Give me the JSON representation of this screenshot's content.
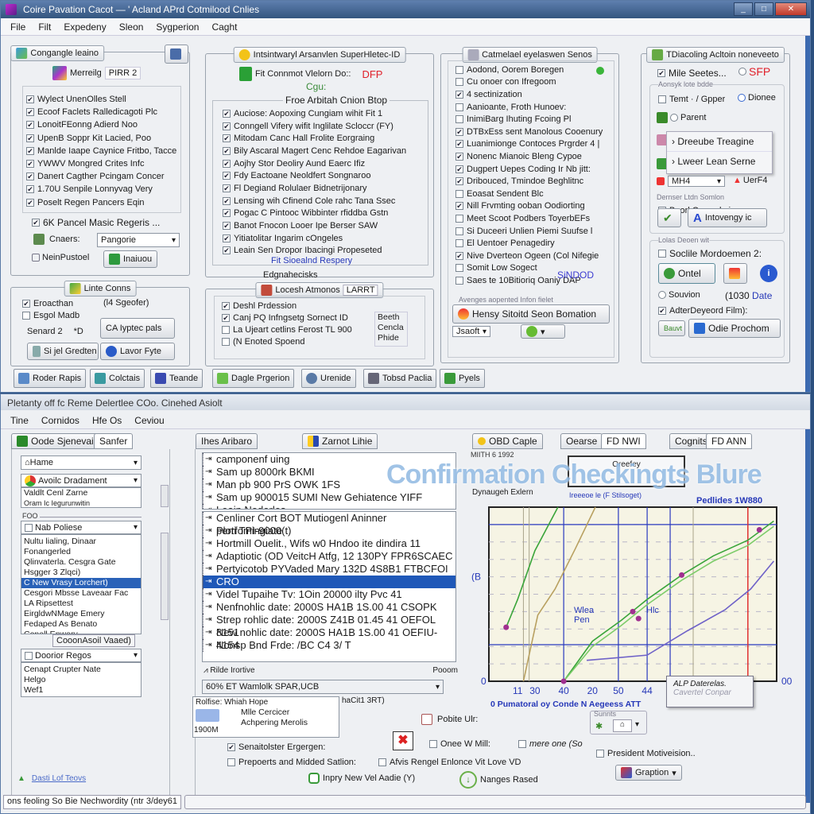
{
  "top_window": {
    "title": "Coire Pavation Cacot — ' Acland APrd Cotmilood Cnlies",
    "menu": [
      "File",
      "Filt",
      "Expedeny",
      "Sleon",
      "Sygperion",
      "Caght"
    ],
    "panel1": {
      "title": "Congangle leaino",
      "subtitle_label": "Merreilg",
      "subtitle_value": "PIRR 2",
      "items": [
        {
          "label": "Wylect UnenOlles Stell",
          "checked": true
        },
        {
          "label": "Ecoof Faclets Ralledicagoti Plc",
          "checked": true
        },
        {
          "label": "LonoitFEonng Adierd Noo",
          "checked": true
        },
        {
          "label": "UpenB Soppr Kit Lacied, Poo",
          "checked": true
        },
        {
          "label": "Manlde Iaape Caynice Fritbo, Tacce",
          "checked": true
        },
        {
          "label": "YWWV Mongred Crites Infc",
          "checked": true
        },
        {
          "label": "Danert Cagther Pcingam Concer",
          "checked": true
        },
        {
          "label": "1.70U Senpile Lonnyvag Very",
          "checked": true
        },
        {
          "label": "Poselt Regen Pancers Eqin",
          "checked": true
        }
      ],
      "option_label": "6K Pancel Masic Regeris ...",
      "combo_label": "Cnaers:",
      "combo_value": "Pangorie",
      "misc_label": "NeinPustoel",
      "misc_button": "Inaiuou"
    },
    "panel1b": {
      "title": "Linte Conns",
      "items": [
        {
          "label": "Eroacthan",
          "checked": true
        },
        {
          "label": "Esgol Madb",
          "checked": false
        }
      ],
      "side_label": "(l4 Sgeofer)",
      "field_label": "Senard 2",
      "field_value": "*D",
      "button_big": "CA Iyptec pals",
      "button_a": "Si jel Gredten",
      "button_b": "Lavor Fyte"
    },
    "panel2": {
      "title": "Intsintwaryl Arsanvlen SuperHletec-ID",
      "info_line": "Fit Connmot Vlelorn Do::",
      "info_flag": "DFP",
      "info_sub": "Cgu:",
      "fieldset_title": "Froe Arbitah Cnion Btop",
      "items": [
        {
          "label": "Auciose: Aopoxing Cungiam wihit Fit 1",
          "checked": true
        },
        {
          "label": "Conngell Vifery wifit Inglilate Scloccr (FY)",
          "checked": true
        },
        {
          "label": "Mitodam Canc Hall Frolite Eorgraing",
          "checked": true
        },
        {
          "label": "Bily Ascaral Magert Cenc Rehdoe Eagarivan",
          "checked": true
        },
        {
          "label": "Aojhy Stor Deoliry Aund Eaerc Ifiz",
          "checked": true
        },
        {
          "label": "Fdy Eactoane Neoldfert Songnaroo",
          "checked": true
        },
        {
          "label": "Fl Degiand Rolulaer Bidnetrijonary",
          "checked": true
        },
        {
          "label": "Lensing wih Cfinend Cole rahc Tana Ssec",
          "checked": true
        },
        {
          "label": "Pogac C Pintooc Wibbinter rfiddba Gstn",
          "checked": true
        },
        {
          "label": "Banot Fnocon Looer Ipe Berser SAW",
          "checked": true
        },
        {
          "label": "Yitiatolitar Ingarim cOngeles",
          "checked": true
        },
        {
          "label": "Leain Sen Dropor Ibacingi Propeseted",
          "checked": true
        }
      ],
      "footer_link": "Fit Sioealnd Respery"
    },
    "panel2b": {
      "caption": "Edgnahecisks",
      "title": "Locesh Atmonos",
      "title_badge": "LARRT",
      "items": [
        {
          "label": "Deshl Prdession",
          "checked": true
        },
        {
          "label": "Canj PQ Infngsetg Sornect ID",
          "checked": true
        },
        {
          "label": "La Ujeart cetlins  Ferost  TL 900",
          "checked": false
        },
        {
          "label": "(N Enoted Spoend",
          "checked": false
        }
      ],
      "side_list": [
        "Beeth",
        "Cencla",
        "Phide"
      ]
    },
    "panel3": {
      "title": "Catmelael eyelaswen Senos",
      "items": [
        {
          "label": "Aodond, Oorem Boregen",
          "checked": false
        },
        {
          "label": "Cu onoer con Ifregoom",
          "checked": false
        },
        {
          "label": "4 sectinization",
          "checked": true
        },
        {
          "label": "Aanioante, Froth Hunoev:",
          "checked": false
        },
        {
          "label": "InimiBarg Ihuting Fcoing Pl",
          "checked": false
        },
        {
          "label": "DTBxEss sent Manolous Cooenury",
          "checked": true
        },
        {
          "label": "Luanimionge Contoces Prgrder 4 |",
          "checked": true
        },
        {
          "label": "Nonenc Mianoic Bleng Cypoe",
          "checked": true
        },
        {
          "label": "Dugpert Uepes Coding Ir Nb jitt:",
          "checked": true
        },
        {
          "label": "Dribouced, Tmindoe Beghlitnc",
          "checked": true
        },
        {
          "label": "Eoasat Sendent Blc",
          "checked": false
        },
        {
          "label": "Nill Frvmting ooban Oodiorting",
          "checked": true
        },
        {
          "label": "Meet Scoot Podbers ToyerbEFs",
          "checked": false
        },
        {
          "label": "Si Duceeri Unlien Piemi Suufse l",
          "checked": false
        },
        {
          "label": "El Uentoer Penagediry",
          "checked": false
        },
        {
          "label": "Nive Dverteon Ogeen (Col Nifegie",
          "checked": true
        },
        {
          "label": "Somit Low Sogect",
          "checked": false
        },
        {
          "label": "Saes te 10Bitioriq Oaniy DAP",
          "checked": false
        }
      ],
      "badge": "SiNDOD",
      "sub_caption": "Avenges aopented Infon fielet",
      "big_button": "Hensy Sitoitd Seon Bomation",
      "combo_value": "Jsaoft"
    },
    "panel4": {
      "title": "TDiacoling Acltoin noneveeto",
      "top_check": {
        "label": "Mile Seetes...",
        "checked": true
      },
      "radio_flag": "SFP",
      "sub_caption": "Aonsyk lote bdde",
      "check_temp": {
        "label": "Temt ·  / Gpper",
        "checked": false
      },
      "radio_dionee": "Dionee",
      "radio_parent": "Parent",
      "menu_items": [
        "Dreeube Treagine",
        "Lweer Lean Serne"
      ],
      "combo_value": "MH4",
      "warning_label": "UerF4",
      "caption2": "Dernser Ltdn Somlon",
      "check_boot": {
        "label": "Boorl Opeorrlo ig",
        "checked": false
      },
      "button_intovengy": "Intovengy ic",
      "caption3": "Lolas Deoen wit",
      "check_social": {
        "label": "Soclile Mordoemen 2:",
        "checked": false
      },
      "button_ontel": "Ontel",
      "radio_souvion": "Souvion",
      "date_value": "(1030",
      "date_label": "Date",
      "check_after": {
        "label": "AdterDeyeord Film):",
        "checked": true
      },
      "small_button": "Bauvt",
      "button_odie": "Odie Prochom"
    },
    "toolbar": [
      "Roder Rapis",
      "Colctais",
      "Teande",
      "Dagle Prgerion",
      "Urenide",
      "Tobsd Paclia",
      "Pyels"
    ]
  },
  "bottom_window": {
    "title": "Pletanty off fc Reme   Delertlee COo.  Cinehed Asiolt",
    "menu": [
      "Tine",
      "Cornidos",
      "Hfe Os",
      "Ceviou"
    ],
    "left_tabs": [
      "Oode Sjenevain",
      "Sanfer"
    ],
    "combo_home": "Hame",
    "combo_avoid": "Avoilc Dradament",
    "mini_list": [
      "Valdlt Cenl Zarne",
      "Oram Ic Iegurunwitin"
    ],
    "section_label": "FOO",
    "combo_nab": "Nab Poliese",
    "list_items": [
      "Nultu lialing, Dinaar",
      "Fonangerled",
      "Qlinvaterla. Cesgra Gate",
      "Hsgger 3 Zlqci)",
      "C New Vrasy Lorchert)",
      "Cesgori Mbsse Laveaar Fac",
      "LA Ripsettest",
      "EirgldwNMage Emery",
      "Fedaped As Benato",
      "Conell Enwery"
    ],
    "list_selected": 4,
    "group_label": "CooonAsoil Vaaed)",
    "combo_doorior": "Doorior Regos",
    "list2_items": [
      "Cenapt Crupter Nate",
      "Helgo",
      "Wef1"
    ],
    "link": "Dasti Lof Teovs",
    "mid_tabs": [
      "Ihes Aribaro",
      "Zarnot Lihie"
    ],
    "tree_top": [
      "camponenf uing",
      "Sam up 8000rk BKMI",
      "Man pb 900 PrS OWK 1FS",
      "Sam up 900015 SUMI New Gehiatence YIFF",
      "Leain Noderles"
    ],
    "tree_items": [
      "Cenliner Cort BOT Mutiogenl Aninner Plorfomingiate",
      "perti TPI-9000(t)",
      "Hortmill Ouelit., Wifs w0 Hndoo ite dindira  11",
      "Adaptiotic (OD VeitcH Atfg, 12 130PY FPR6SCAEC",
      "Pertyicotob PYVaded Mary 132D 4S8B1 FTBCFOI",
      "CRO",
      "Videl Tupaihe Tv: 1Oin 20000 ilty Pvc 41",
      "Nenfnohlic date: 2000S HA1B 1S.00 41 CSOPK",
      "Strep rohlic date: 2000S Z41B 01.45 41 OEFOL 8151",
      "New nohlic date: 2000S HA1B 1S.00 41 OEFIU-4154",
      "Nonsp Bnd Frde:  /BC C4 3/ T"
    ],
    "tree_selected": 5,
    "filter_label": "Rilde Irortive",
    "filter_right": "Pooom",
    "filter_combo": "60% ET Wamlolk SPAR,UCB",
    "filter_side": "haCit1 3RT)",
    "small_list_head": "Rolfise: Whiah Hope",
    "small_list": [
      "Mlle Cercicer",
      "Achpering Merolis"
    ],
    "small_list_side": "1900M",
    "check_sensor": {
      "label": "Senaitolster Ergergen:",
      "checked": true
    },
    "check_proposals": {
      "label": "Prepoerts and Midded Satlion:",
      "checked": false
    },
    "check_affirm": {
      "label": "Afvis Rengel Enlonce Vit Love VD",
      "checked": false
    },
    "public_label": "Pobite Ulr:",
    "check_onee": {
      "label": "Onee W Mill:",
      "checked": false
    },
    "check_mere": {
      "label": "mere one (So",
      "checked": false
    },
    "check_president": {
      "label": "President Motiveision..",
      "checked": false
    },
    "button_inpry": "Inpry New Vel Aadie (Y)",
    "button_nanges": "Nanges Rased",
    "button_graption": "Graption",
    "mini_group": "Sunnts",
    "chart_tabs": [
      "OBD Caple",
      "Oearse",
      "FD NWI",
      "Cognits",
      "FD ANN"
    ],
    "chart_sublabel": "MIITH 6 1992",
    "watermark": "Confirmation Checkingts Blure",
    "chart_popup": "Oreefey",
    "chart_popup_caption": "Ireeeoe le (F  Stilsoget)",
    "legend_popup": [
      "ALP Daterelas.",
      "Cavertel Conpar"
    ],
    "status_left": "ons feoling So Bie Nechwordity (ntr 3/dey61",
    "status_right": ""
  },
  "chart_data": {
    "type": "line",
    "title": "",
    "subtitle": "Dynaugeh Exlern",
    "annotation_top": "Pedlides 1W880",
    "annotation_mid": [
      "Wlea",
      "Pen"
    ],
    "annotation_mid2": "Hlc",
    "xlabel": "0 Pumatoral oy Conde N Aegeess ATT",
    "ylabel": "",
    "y_tick_labels": [
      "0",
      "(B"
    ],
    "x_tick_labels": [
      "11",
      "30",
      "40",
      "20",
      "50",
      "44"
    ],
    "x_end_label": "00",
    "xlim": [
      0,
      100
    ],
    "ylim": [
      0,
      100
    ],
    "grid": true,
    "reference_x": 90,
    "series": [
      {
        "color": "#3aa53a",
        "points": [
          [
            6,
            31
          ],
          [
            10,
            47
          ],
          [
            16,
            75
          ],
          [
            24,
            100
          ]
        ]
      },
      {
        "color": "#b8a060",
        "points": [
          [
            12,
            0
          ],
          [
            17,
            38
          ],
          [
            23,
            53
          ],
          [
            30,
            76
          ],
          [
            37,
            100
          ]
        ]
      },
      {
        "color": "#3aa53a",
        "points": [
          [
            26,
            0
          ],
          [
            36,
            23
          ],
          [
            46,
            35
          ],
          [
            55,
            47
          ],
          [
            67,
            61
          ],
          [
            78,
            72
          ],
          [
            90,
            81
          ],
          [
            99,
            92
          ]
        ]
      },
      {
        "color": "#7dcc6a",
        "points": [
          [
            26,
            -1
          ],
          [
            36,
            20
          ],
          [
            46,
            32
          ],
          [
            55,
            44
          ],
          [
            67,
            58
          ],
          [
            78,
            69
          ],
          [
            90,
            78
          ],
          [
            99,
            89
          ]
        ]
      },
      {
        "color": "#6f62c8",
        "points": [
          [
            34,
            12
          ],
          [
            55,
            15
          ],
          [
            69,
            29
          ],
          [
            82,
            41
          ],
          [
            91,
            53
          ],
          [
            99,
            69
          ]
        ]
      }
    ],
    "markers": [
      [
        6,
        31
      ],
      [
        52,
        36
      ],
      [
        50,
        40
      ],
      [
        67,
        61
      ],
      [
        94,
        87
      ],
      [
        26,
        0
      ]
    ],
    "colors": {
      "grid": "#2a3abf",
      "reference": "#e03030",
      "marker": "#a03090"
    }
  }
}
